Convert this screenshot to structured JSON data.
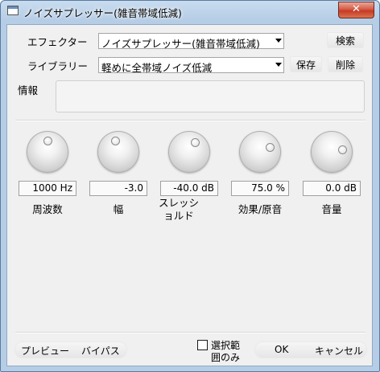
{
  "window": {
    "title": "ノイズサプレッサー(雑音帯域低減)",
    "close_glyph": "✕"
  },
  "effector": {
    "label": "エフェクター",
    "value": "ノイズサプレッサー(雑音帯域低減)",
    "search_label": "検索"
  },
  "library": {
    "label": "ライブラリー",
    "value": "軽めに全帯域ノイズ低減",
    "save_label": "保存",
    "delete_label": "削除"
  },
  "info": {
    "label": "情報",
    "text": ""
  },
  "knobs": [
    {
      "value": "1000 Hz",
      "name": "周波数",
      "level": 0.5
    },
    {
      "value": "-3.0",
      "name": "幅",
      "level": 0.45
    },
    {
      "value": "-40.0 dB",
      "name": "スレッショルド",
      "level": 0.62
    },
    {
      "value": "75.0 %",
      "name": "効果/原音",
      "level": 0.75
    },
    {
      "value": "0.0 dB",
      "name": "音量",
      "level": 0.8
    }
  ],
  "footer": {
    "preview_label": "プレビュー",
    "bypass_label": "バイパス",
    "selection_only_label": "選択範囲のみ",
    "selection_only_checked": false,
    "ok_label": "OK",
    "cancel_label": "キャンセル"
  }
}
